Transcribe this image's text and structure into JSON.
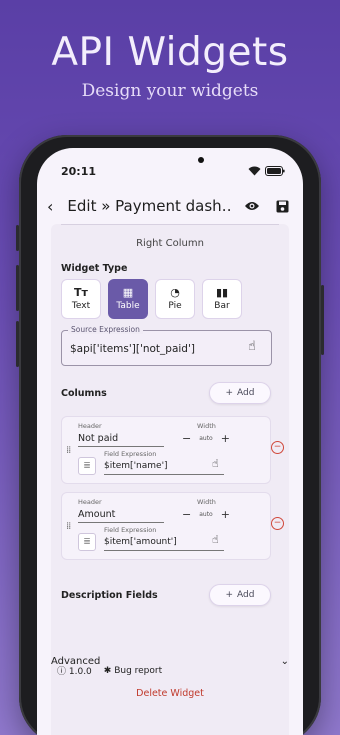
{
  "hero": {
    "title": "API Widgets",
    "subtitle": "Design your widgets"
  },
  "status_bar": {
    "time": "20:11"
  },
  "appbar": {
    "title": "Edit » Payment dash…"
  },
  "column_title": "Right Column",
  "widget_type": {
    "label": "Widget Type",
    "options": [
      {
        "label": "Text",
        "icon": "text-icon",
        "glyph": "Tт",
        "selected": false
      },
      {
        "label": "Table",
        "icon": "table-icon",
        "glyph": "▦",
        "selected": true
      },
      {
        "label": "Pie",
        "icon": "pie-icon",
        "glyph": "◔",
        "selected": false
      },
      {
        "label": "Bar",
        "icon": "bar-icon",
        "glyph": "▮▮",
        "selected": false
      }
    ]
  },
  "source": {
    "legend": "Source Expression",
    "value": "$api['items']['not_paid']"
  },
  "columns": {
    "label": "Columns",
    "add_label": "Add",
    "items": [
      {
        "header_label": "Header",
        "header": "Not paid",
        "width_label": "Width",
        "width": "auto",
        "field_label": "Field Expression",
        "field": "$item['name']"
      },
      {
        "header_label": "Header",
        "header": "Amount",
        "width_label": "Width",
        "width": "auto",
        "field_label": "Field Expression",
        "field": "$item['amount']"
      }
    ]
  },
  "description_fields": {
    "label": "Description Fields",
    "add_label": "Add"
  },
  "advanced": {
    "label": "Advanced"
  },
  "footer": {
    "version": "1.0.0",
    "bug_report": "Bug report",
    "delete": "Delete Widget"
  },
  "colors": {
    "accent": "#6a5aa8",
    "danger": "#c0392b",
    "background_top": "#5a3fa6"
  }
}
